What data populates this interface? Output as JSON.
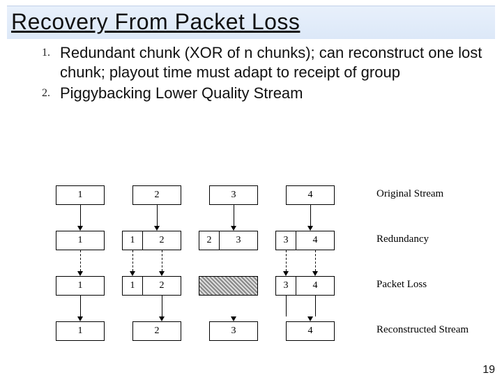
{
  "title": "Recovery From Packet Loss",
  "list": [
    {
      "num": "1.",
      "text": "Redundant chunk (XOR of n chunks); can reconstruct one lost chunk; playout time must adapt to receipt of group"
    },
    {
      "num": "2.",
      "text": "Piggybacking Lower Quality Stream"
    }
  ],
  "diagram": {
    "rows": [
      {
        "label": "Original Stream",
        "cells": [
          "1",
          "2",
          "3",
          "4"
        ]
      },
      {
        "label": "Redundancy",
        "cells": [
          "1",
          "1",
          "2",
          "2",
          "3",
          "3",
          "4"
        ]
      },
      {
        "label": "Packet Loss",
        "cells": [
          "1",
          "1",
          "2",
          "",
          "3",
          "4"
        ]
      },
      {
        "label": "Reconstructed Stream",
        "cells": [
          "1",
          "2",
          "3",
          "4"
        ]
      }
    ]
  },
  "page_number": "19"
}
